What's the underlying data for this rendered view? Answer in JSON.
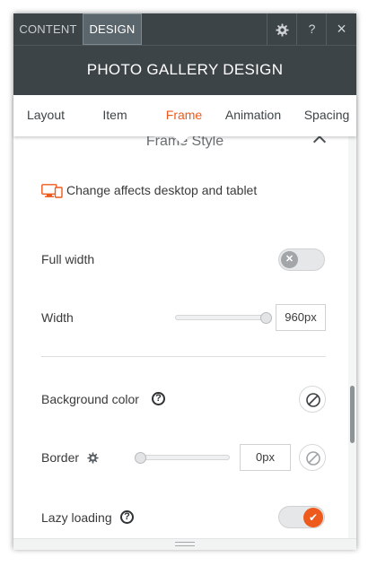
{
  "topbar": {
    "tabs": [
      {
        "label": "CONTENT",
        "active": false
      },
      {
        "label": "DESIGN",
        "active": true
      }
    ],
    "icons": [
      "gear-icon",
      "help-icon",
      "close-icon"
    ],
    "help_label": "?",
    "close_label": "×"
  },
  "header": {
    "title": "PHOTO GALLERY DESIGN"
  },
  "subtabs": [
    {
      "label": "Layout"
    },
    {
      "label": "Item"
    },
    {
      "label": "Frame",
      "active": true
    },
    {
      "label": "Animation"
    },
    {
      "label": "Spacing"
    }
  ],
  "section": {
    "title": "Frame Style",
    "notice": "Change affects desktop and tablet"
  },
  "settings": {
    "full_width": {
      "label": "Full width",
      "enabled": false
    },
    "width": {
      "label": "Width",
      "value": "960px",
      "slider_level": 1.0
    },
    "background_color": {
      "label": "Background color",
      "help": "?",
      "value": "none"
    },
    "border": {
      "label": "Border",
      "value": "0px",
      "slider_level": 0.0,
      "color": "none"
    },
    "lazy_loading": {
      "label": "Lazy loading",
      "help": "?",
      "enabled": true
    }
  },
  "colors": {
    "accent": "#ee5a1c",
    "dark_header": "#3d4447",
    "active_tab": "#5a666c"
  }
}
